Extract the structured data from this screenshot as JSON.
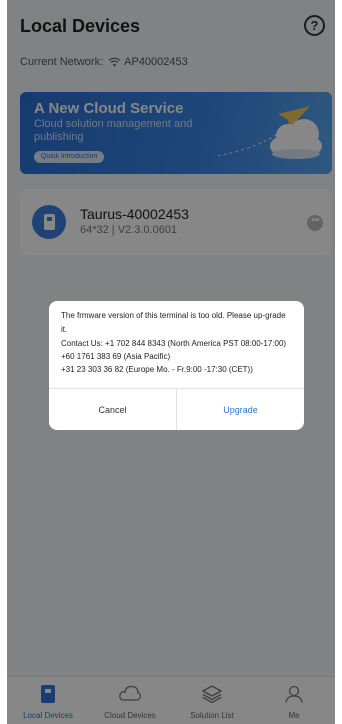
{
  "header": {
    "title": "Local Devices",
    "help_glyph": "?"
  },
  "network": {
    "label": "Current Network:",
    "ssid": "AP40002453"
  },
  "banner": {
    "title": "A New Cloud Service",
    "subtitle": "Cloud solution management and publishing",
    "button_label": "Quick Introduction"
  },
  "device": {
    "name": "Taurus-40002453",
    "meta": "64*32 | V2.3.0.0601",
    "more_glyph": "•••"
  },
  "dialog": {
    "message": "The frmware version of this terminal is too old. Please up-grade it.",
    "contact_lines": [
      "Contact Us: +1 702 844 8343 (North America PST 08:00-17:00)",
      "+60 1761 383 69 (Asia Pacific)",
      "+31 23 303 36 82 (Europe Mo. - Fr.9:00 -17:30 (CET))"
    ],
    "cancel_label": "Cancel",
    "upgrade_label": "Upgrade"
  },
  "tabbar": {
    "items": [
      {
        "label": "Local Devices",
        "icon": "device-icon",
        "active": true
      },
      {
        "label": "Cloud Devices",
        "icon": "cloud-icon",
        "active": false
      },
      {
        "label": "Solution List",
        "icon": "layers-icon",
        "active": false
      },
      {
        "label": "Me",
        "icon": "person-icon",
        "active": false
      }
    ]
  },
  "colors": {
    "accent": "#2f73d8",
    "banner": "#3a86e6",
    "overlay": "rgba(0,0,0,0.47)"
  }
}
